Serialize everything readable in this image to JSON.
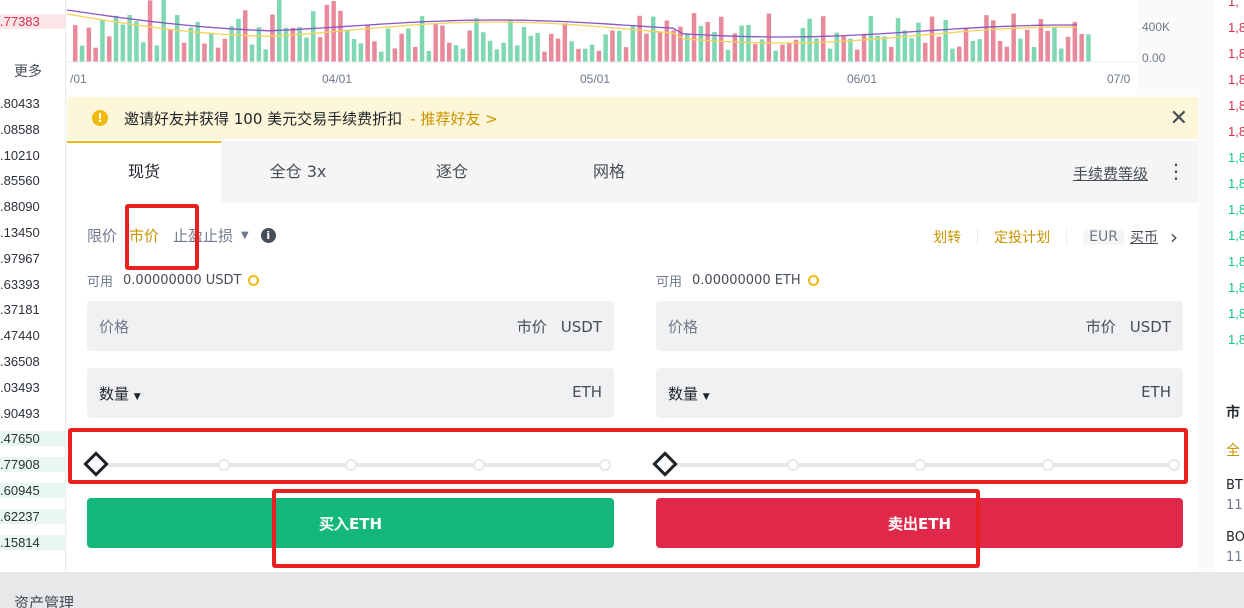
{
  "orderbook_left": {
    "top_value": ".77383",
    "more_label": "更多",
    "values": [
      ".80433",
      ".08588",
      ".10210",
      ".85560",
      ".88090",
      ".13450",
      ".97967",
      ".63393",
      ".37181",
      ".47440",
      ".36508",
      ".03493",
      ".90493",
      ".47650",
      ".77908",
      ".60945",
      ".62237",
      ".15814"
    ]
  },
  "chart": {
    "y_ticks": [
      "400K",
      "0.00"
    ],
    "x_ticks": [
      "/01",
      "04/01",
      "05/01",
      "06/01",
      "07/0"
    ]
  },
  "banner": {
    "text": "邀请好友并获得 100 美元交易手续费折扣",
    "link": "- 推荐好友 >",
    "close": "✕"
  },
  "tabs": [
    {
      "label": "现货",
      "active": true
    },
    {
      "label": "全仓 3x",
      "active": false
    },
    {
      "label": "逐仓",
      "active": false
    },
    {
      "label": "网格",
      "active": false
    }
  ],
  "fee_level": "手续费等级",
  "more_icon": "⋮",
  "order_types": {
    "limit": "限价",
    "market": "市价",
    "stop": "止盈止损",
    "info": "i"
  },
  "tools": {
    "transfer": "划转",
    "auto_invest": "定投计划",
    "eur": "EUR",
    "buy_crypto": "买币",
    "chevron": "›"
  },
  "buy": {
    "avail_label": "可用",
    "avail_value": "0.00000000 USDT",
    "price_label": "价格",
    "price_mode": "市价",
    "price_unit": "USDT",
    "amount_label": "数量",
    "amount_unit": "ETH",
    "slider_value": 0,
    "button": "买入ETH"
  },
  "sell": {
    "avail_label": "可用",
    "avail_value": "0.00000000 ETH",
    "price_label": "价格",
    "price_mode": "市价",
    "price_unit": "USDT",
    "amount_label": "数量",
    "amount_unit": "ETH",
    "slider_value": 0,
    "button": "卖出ETH"
  },
  "right_col": {
    "values": [
      "1,",
      "1,8",
      "1,8",
      "1,8",
      "1,8",
      "1,8",
      "1,8",
      "1,8",
      "1,8",
      "1,8",
      "1,8",
      "1,8",
      "1,8",
      "1,8"
    ],
    "text1": "市",
    "text2": "全",
    "text3": "BT",
    "text4": "11",
    "text5": "BO",
    "text6": "11"
  },
  "bottom": {
    "label": "资产管理"
  },
  "colors": {
    "accent": "#f0b90b",
    "buy": "#14b87a",
    "sell": "#e0294a",
    "highlight": "#ea1f1f"
  }
}
